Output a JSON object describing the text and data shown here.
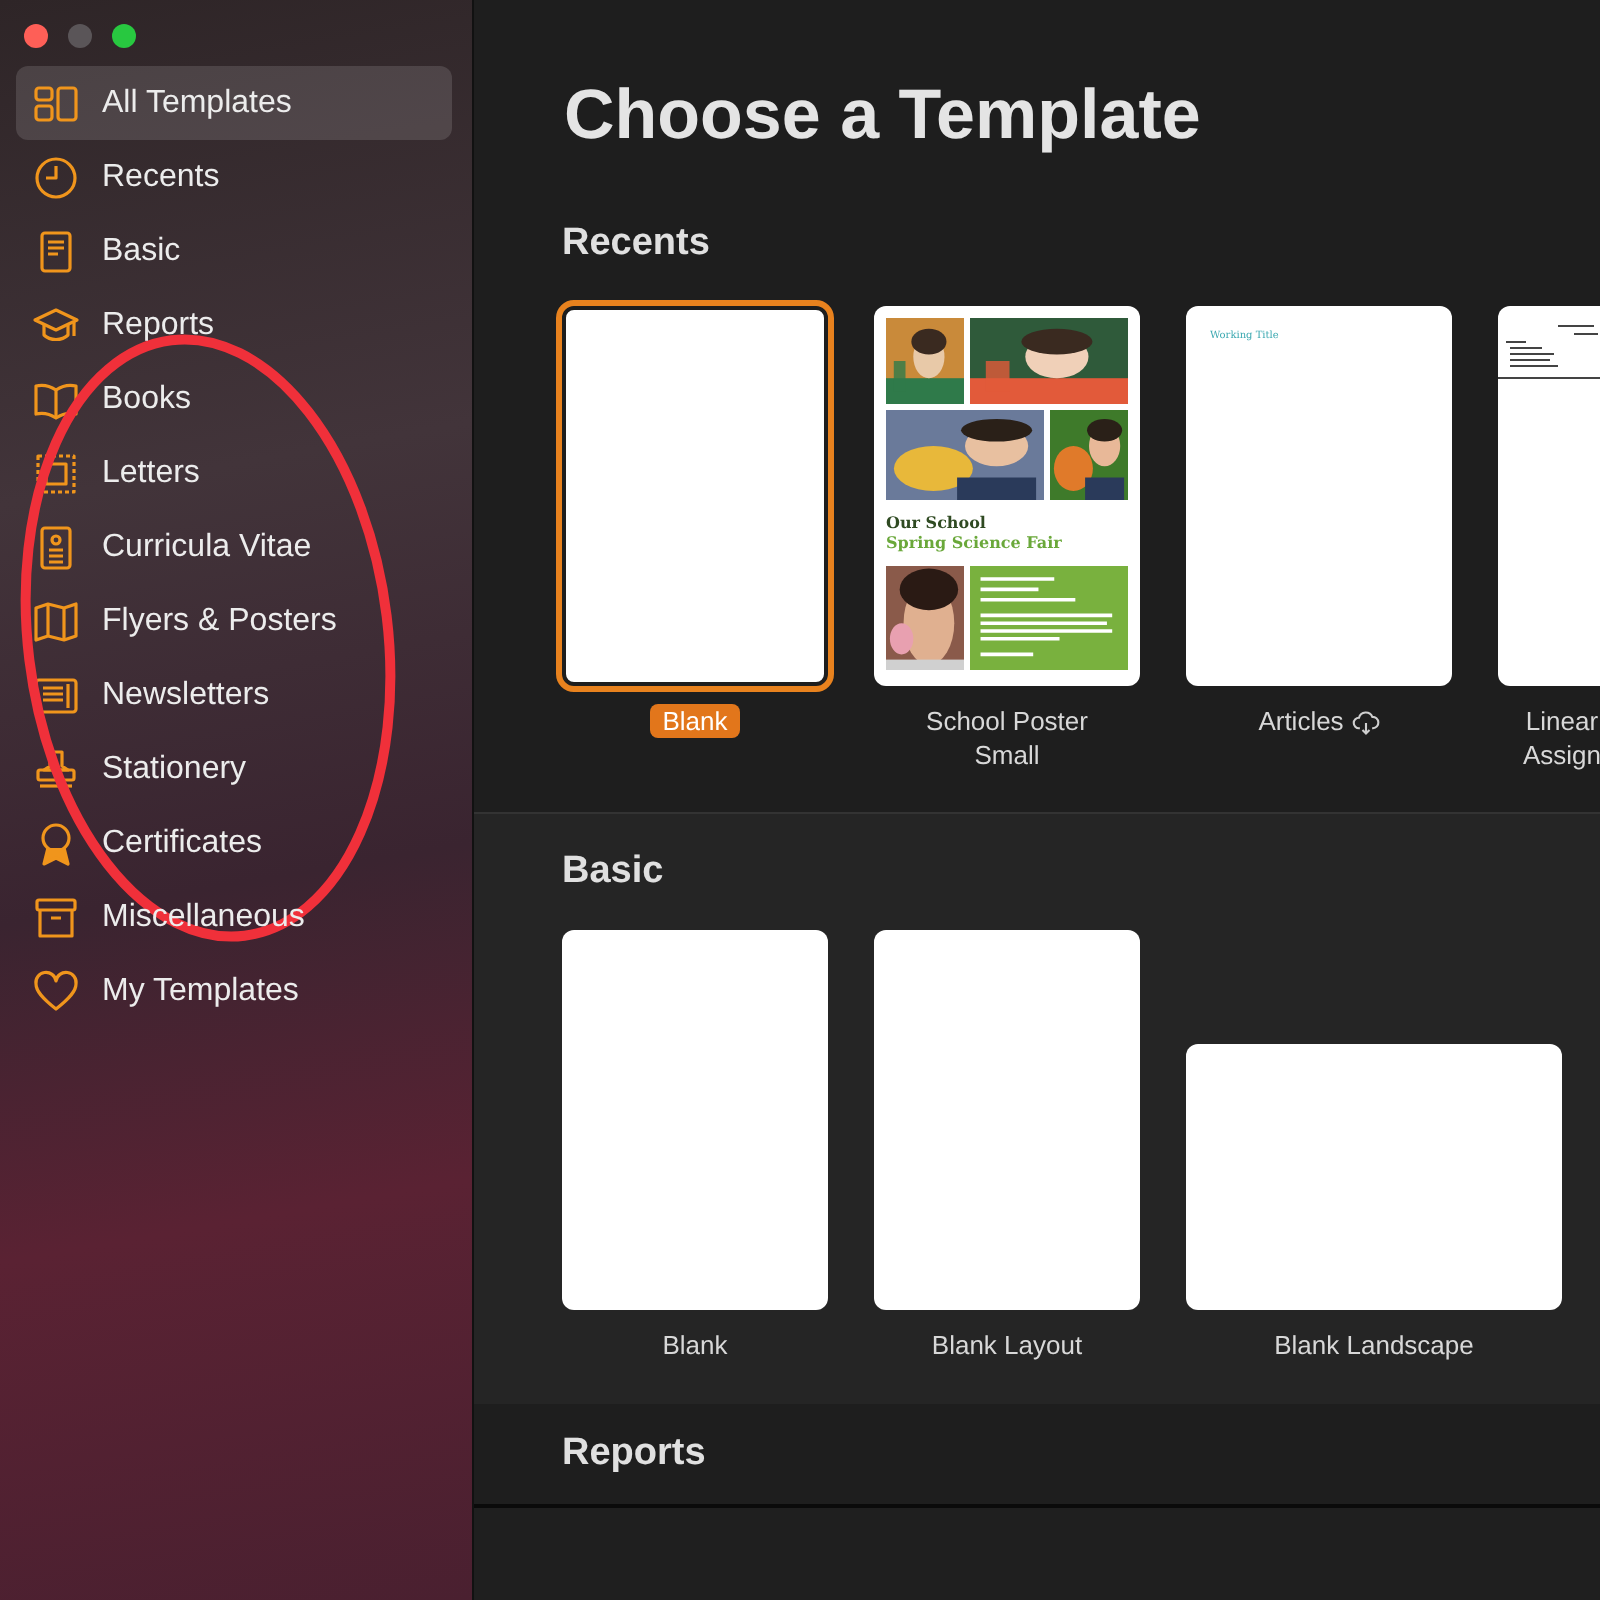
{
  "window": {
    "title": "Choose a Template"
  },
  "sidebar": {
    "items": [
      {
        "label": "All Templates",
        "selected": true
      },
      {
        "label": "Recents",
        "selected": false
      },
      {
        "label": "Basic",
        "selected": false
      },
      {
        "label": "Reports",
        "selected": false
      },
      {
        "label": "Books",
        "selected": false
      },
      {
        "label": "Letters",
        "selected": false
      },
      {
        "label": "Curricula Vitae",
        "selected": false
      },
      {
        "label": "Flyers & Posters",
        "selected": false
      },
      {
        "label": "Newsletters",
        "selected": false
      },
      {
        "label": "Stationery",
        "selected": false
      },
      {
        "label": "Certificates",
        "selected": false
      },
      {
        "label": "Miscellaneous",
        "selected": false
      },
      {
        "label": "My Templates",
        "selected": false
      }
    ]
  },
  "sections": [
    {
      "title": "Recents",
      "templates": [
        {
          "kind": "blank",
          "label": "Blank",
          "selected": true,
          "downloadable": false
        },
        {
          "kind": "poster",
          "label": "School Poster Small",
          "selected": false,
          "downloadable": false,
          "heading": "Our School",
          "subheading": "Spring Science Fair"
        },
        {
          "kind": "article",
          "label": "Articles",
          "selected": false,
          "downloadable": true,
          "heading": "Working Title"
        },
        {
          "kind": "assignment",
          "label": "Linear Assign",
          "selected": false,
          "downloadable": false,
          "clipped": true
        }
      ]
    },
    {
      "title": "Basic",
      "templates": [
        {
          "kind": "blank",
          "label": "Blank",
          "selected": false,
          "downloadable": false
        },
        {
          "kind": "blank",
          "label": "Blank Layout",
          "selected": false,
          "downloadable": false
        },
        {
          "kind": "landscape",
          "label": "Blank Landscape",
          "selected": false,
          "downloadable": false
        }
      ]
    },
    {
      "title": "Reports",
      "templates": [
        {
          "kind": "hidden"
        },
        {
          "kind": "hidden"
        },
        {
          "kind": "hidden"
        },
        {
          "kind": "hidden"
        }
      ]
    }
  ],
  "annotation": {
    "kind": "ellipse"
  }
}
